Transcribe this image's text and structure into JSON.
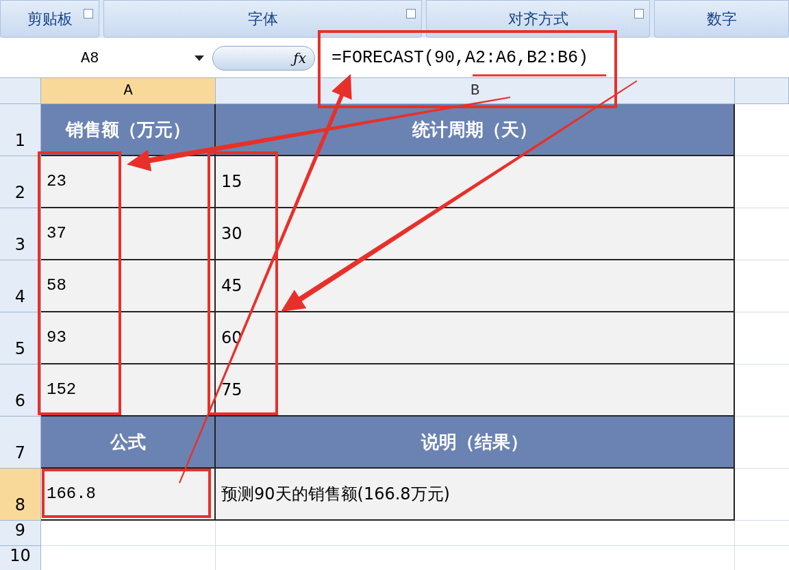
{
  "ribbon_groups": [
    {
      "label": "剪贴板",
      "launcher": true
    },
    {
      "label": "字体",
      "launcher": true
    },
    {
      "label": "对齐方式",
      "launcher": true
    },
    {
      "label": "数字",
      "launcher": false
    }
  ],
  "formula_bar": {
    "name_box": "A8",
    "function_label": "ƒx",
    "formula": "=FORECAST(90,A2:A6,B2:B6)"
  },
  "columns": [
    {
      "label": "A",
      "selected": true
    },
    {
      "label": "B",
      "selected": false
    },
    {
      "selected": false
    }
  ],
  "rows": [
    {
      "number": "1",
      "selected": false,
      "kind": "header",
      "cells": [
        "销售额（万元）",
        "统计周期（天）"
      ]
    },
    {
      "number": "2",
      "selected": false,
      "kind": "data",
      "cells": [
        "23",
        "15"
      ]
    },
    {
      "number": "3",
      "selected": false,
      "kind": "data",
      "cells": [
        "37",
        "30"
      ]
    },
    {
      "number": "4",
      "selected": false,
      "kind": "data",
      "cells": [
        "58",
        "45"
      ]
    },
    {
      "number": "5",
      "selected": false,
      "kind": "data",
      "cells": [
        "93",
        "60"
      ]
    },
    {
      "number": "6",
      "selected": false,
      "kind": "data",
      "cells": [
        "152",
        "75"
      ]
    },
    {
      "number": "7",
      "selected": false,
      "kind": "header",
      "cells": [
        "公式",
        "说明（结果）"
      ]
    },
    {
      "number": "8",
      "selected": true,
      "kind": "data",
      "cells": [
        "166.8",
        "预测90天的销售额(166.8万元)"
      ]
    },
    {
      "number": "9",
      "selected": false,
      "kind": "empty"
    },
    {
      "number": "10",
      "selected": false,
      "kind": "empty"
    }
  ]
}
